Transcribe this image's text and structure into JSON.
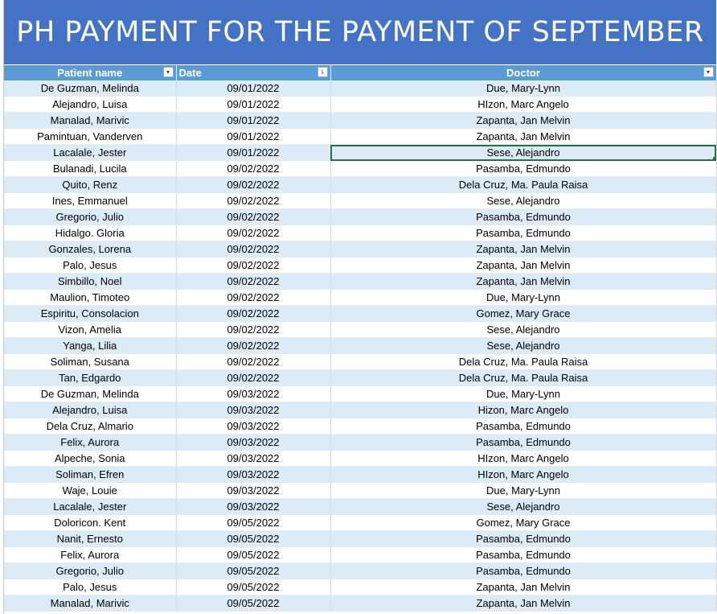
{
  "title": "PH PAYMENT FOR THE PAYMENT OF SEPTEMBER",
  "columns": {
    "patient": "Patient name",
    "date": "Date",
    "doctor": "Doctor"
  },
  "filter_icons": {
    "patient": "▾",
    "date": "⇂",
    "doctor": "▾"
  },
  "colors": {
    "title_bg": "#4472c4",
    "header_bg": "#5b9bd5",
    "band": "#ddebf7",
    "selection": "#217346"
  },
  "rows": [
    {
      "patient": "De Guzman, Melinda",
      "date": "09/01/2022",
      "doctor": "Due, Mary-Lynn"
    },
    {
      "patient": "Alejandro, Luisa",
      "date": "09/01/2022",
      "doctor": "HIzon, Marc Angelo"
    },
    {
      "patient": "Manalad, Marivic",
      "date": "09/01/2022",
      "doctor": "Zapanta, Jan Melvin"
    },
    {
      "patient": "Pamintuan, Vanderven",
      "date": "09/01/2022",
      "doctor": "Zapanta, Jan Melvin"
    },
    {
      "patient": "Lacalale, Jester",
      "date": "09/01/2022",
      "doctor": "Sese, Alejandro"
    },
    {
      "patient": "Bulanadi, Lucila",
      "date": "09/02/2022",
      "doctor": "Pasamba, Edmundo"
    },
    {
      "patient": "Quito, Renz",
      "date": "09/02/2022",
      "doctor": "Dela Cruz, Ma. Paula Raisa"
    },
    {
      "patient": "Ines, Emmanuel",
      "date": "09/02/2022",
      "doctor": "Sese, Alejandro"
    },
    {
      "patient": "Gregorio, Julio",
      "date": "09/02/2022",
      "doctor": "Pasamba, Edmundo"
    },
    {
      "patient": "Hidalgo. Gloria",
      "date": "09/02/2022",
      "doctor": "Pasamba, Edmundo"
    },
    {
      "patient": "Gonzales, Lorena",
      "date": "09/02/2022",
      "doctor": "Zapanta, Jan Melvin"
    },
    {
      "patient": "Palo, Jesus",
      "date": "09/02/2022",
      "doctor": "Zapanta, Jan Melvin"
    },
    {
      "patient": "Simbillo, Noel",
      "date": "09/02/2022",
      "doctor": "Zapanta, Jan Melvin"
    },
    {
      "patient": "Maulion, Timoteo",
      "date": "09/02/2022",
      "doctor": "Due, Mary-Lynn"
    },
    {
      "patient": "Espiritu, Consolacion",
      "date": "09/02/2022",
      "doctor": "Gomez, Mary Grace"
    },
    {
      "patient": "Vizon, Amelia",
      "date": "09/02/2022",
      "doctor": "Sese, Alejandro"
    },
    {
      "patient": "Yanga, Lilia",
      "date": "09/02/2022",
      "doctor": "Sese, Alejandro"
    },
    {
      "patient": "Soliman, Susana",
      "date": "09/02/2022",
      "doctor": "Dela Cruz, Ma. Paula Raisa"
    },
    {
      "patient": "Tan, Edgardo",
      "date": "09/02/2022",
      "doctor": "Dela Cruz, Ma. Paula Raisa"
    },
    {
      "patient": "De Guzman, Melinda",
      "date": "09/03/2022",
      "doctor": "Due, Mary-Lynn"
    },
    {
      "patient": "Alejandro, Luisa",
      "date": "09/03/2022",
      "doctor": "Hizon, Marc Angelo"
    },
    {
      "patient": "Dela Cruz, Almario",
      "date": "09/03/2022",
      "doctor": "Pasamba, Edmundo"
    },
    {
      "patient": "Felix, Aurora",
      "date": "09/03/2022",
      "doctor": "Pasamba, Edmundo"
    },
    {
      "patient": "Alpeche, Sonia",
      "date": "09/03/2022",
      "doctor": "HIzon, Marc Angelo"
    },
    {
      "patient": "Soliman, Efren",
      "date": "09/03/2022",
      "doctor": "HIzon, Marc Angelo"
    },
    {
      "patient": "Waje, Louie",
      "date": "09/03/2022",
      "doctor": "Due, Mary-Lynn"
    },
    {
      "patient": "Lacalale, Jester",
      "date": "09/03/2022",
      "doctor": "Sese, Alejandro"
    },
    {
      "patient": "Doloricon. Kent",
      "date": "09/05/2022",
      "doctor": "Gomez, Mary Grace"
    },
    {
      "patient": "Nanit, Ernesto",
      "date": "09/05/2022",
      "doctor": "Pasamba, Edmundo"
    },
    {
      "patient": "Felix, Aurora",
      "date": "09/05/2022",
      "doctor": "Pasamba, Edmundo"
    },
    {
      "patient": "Gregorio, Julio",
      "date": "09/05/2022",
      "doctor": "Pasamba, Edmundo"
    },
    {
      "patient": "Palo, Jesus",
      "date": "09/05/2022",
      "doctor": "Zapanta, Jan Melvin"
    },
    {
      "patient": "Manalad, Marivic",
      "date": "09/05/2022",
      "doctor": "Zapanta, Jan Melvin"
    }
  ]
}
